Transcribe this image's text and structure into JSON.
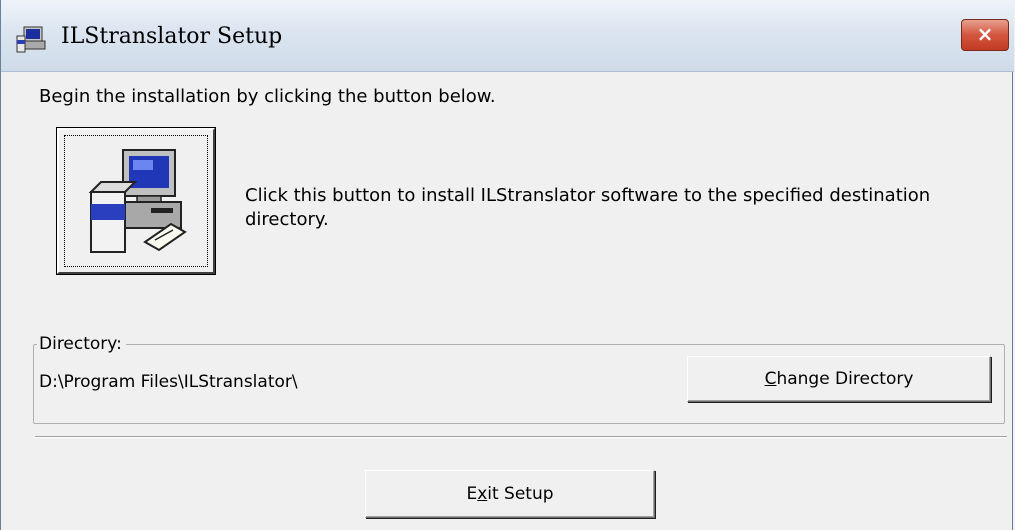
{
  "window": {
    "title": "ILStranslator Setup",
    "close_label": "×"
  },
  "intro_text": "Begin the installation by clicking the button below.",
  "install": {
    "description": "Click this button to install ILStranslator software to the specified destination directory."
  },
  "directory": {
    "group_label": "Directory:",
    "path": "D:\\Program Files\\ILStranslator\\",
    "change_button": {
      "mnemonic": "C",
      "rest": "hange Directory"
    }
  },
  "exit_button": {
    "before": "E",
    "mnemonic": "x",
    "rest": "it Setup"
  },
  "icons": {
    "title_icon": "setup-computer-icon",
    "install_icon": "computer-install-icon"
  },
  "colors": {
    "titlebar": "#dbe5f0",
    "close_button": "#d4563f",
    "background": "#f0f0f0"
  }
}
